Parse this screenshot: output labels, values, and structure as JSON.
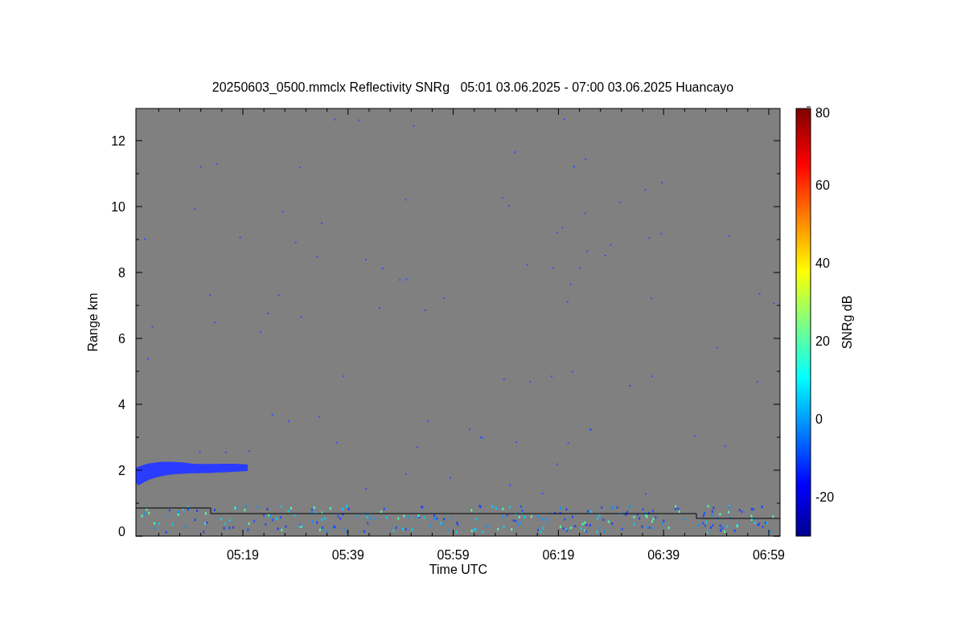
{
  "title": "20250603_0500.mmclx Reflectivity SNRg   05:01 03.06.2025 - 07:00 03.06.2025 Huancayo",
  "plot": {
    "xlabel": "Time UTC",
    "ylabel": "Range km",
    "xticks": [
      "05:19",
      "05:39",
      "05:59",
      "06:19",
      "06:39",
      "06:59"
    ],
    "yticks": [
      "12",
      "10",
      "8",
      "6",
      "4",
      "2",
      "0"
    ]
  },
  "colorbar": {
    "label": "SNRg dB",
    "ticks": [
      "80",
      "60",
      "40",
      "20",
      "0",
      "-20"
    ]
  }
}
